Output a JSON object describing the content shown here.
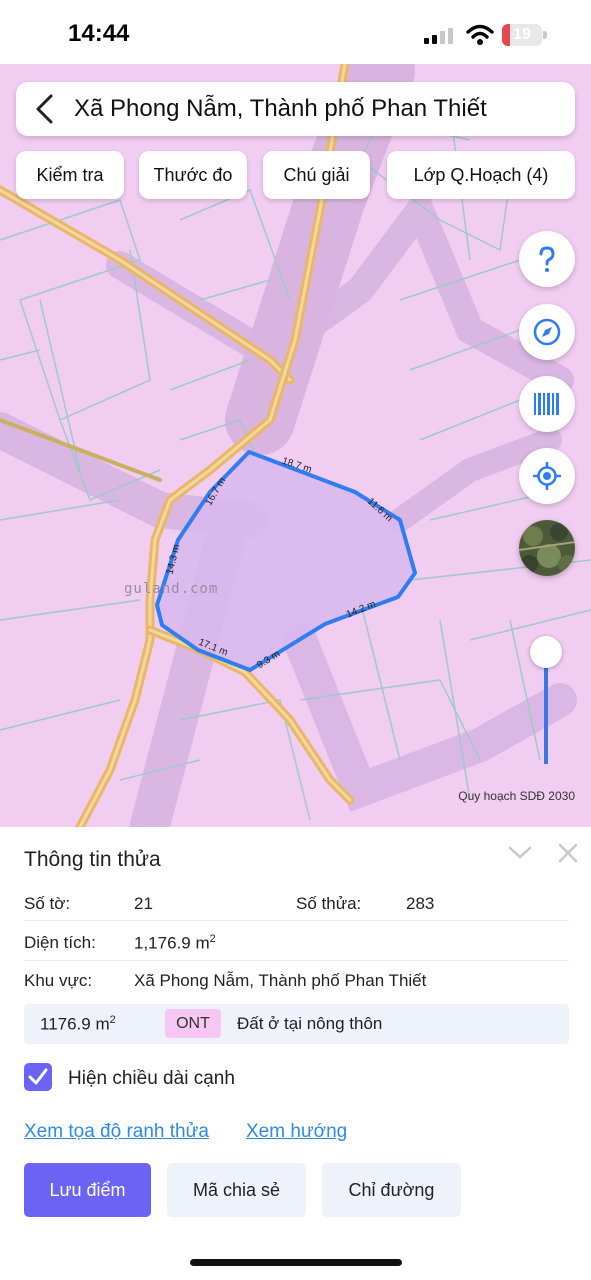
{
  "status_bar": {
    "time": "14:44",
    "battery_level": "19",
    "battery_fraction": 0.19,
    "battery_color": "#e5484d"
  },
  "header": {
    "back_icon": "chevron-left-icon",
    "title": "Xã Phong Nẫm, Thành phố Phan Thiết"
  },
  "toolbar": {
    "check_label": "Kiểm tra",
    "measure_label": "Thước đo",
    "legend_label": "Chú giải",
    "layers_label": "Lớp Q.Hoạch (4)"
  },
  "map_controls": {
    "help_icon": "question-icon",
    "compass_icon": "compass-icon",
    "barcode_icon": "barcode-icon",
    "locate_icon": "locate-icon",
    "satellite_icon": "satellite-thumbnail",
    "zoom_level": 0.9
  },
  "map": {
    "source_label": "Quy hoạch SDĐ 2030",
    "watermark": "guland.com",
    "edge_labels": [
      "18.7 m",
      "11.6 m",
      "14.2 m",
      "9.3 m",
      "17.1 m",
      "14.3 m",
      "16.7 m"
    ],
    "colors": {
      "land_pink": "#f2cdf2",
      "road_yellow": "#e8b868",
      "parcel_border": "#2f7df0",
      "parcel_fill": "#d8b8ef",
      "overlay": "#c9a3d6"
    }
  },
  "info_panel": {
    "title": "Thông tin thửa",
    "sheet_label": "Số tờ:",
    "sheet_value": "21",
    "parcel_label": "Số thửa:",
    "parcel_value": "283",
    "area_label": "Diện tích:",
    "area_value": "1,176.9 m",
    "area_unit_sup": "2",
    "region_label": "Khu vực:",
    "region_value": "Xã Phong Nẫm, Thành phố Phan Thiết",
    "land_use": {
      "area": "1176.9 m",
      "area_unit_sup": "2",
      "code": "ONT",
      "description": "Đất ở tại nông thôn"
    },
    "show_edges_label": "Hiện chiều dài cạnh",
    "show_edges_checked": true,
    "link_coordinates": "Xem tọa độ ranh thửa",
    "link_direction": "Xem hướng",
    "btn_save": "Lưu điểm",
    "btn_share": "Mã chia sẻ",
    "btn_directions": "Chỉ đường"
  }
}
